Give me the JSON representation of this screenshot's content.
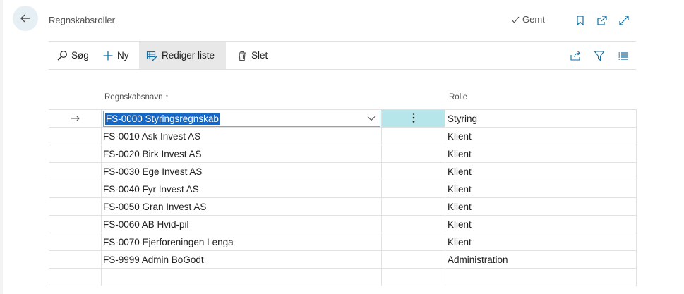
{
  "page": {
    "title": "Regnskabsroller",
    "saved_label": "Gemt"
  },
  "toolbar": {
    "search_label": "Søg",
    "new_label": "Ny",
    "edit_list_label": "Rediger liste",
    "delete_label": "Slet"
  },
  "columns": {
    "name_header": "Regnskabsnavn ↑",
    "role_header": "Rolle"
  },
  "rows": [
    {
      "name": "FS-0000 Styringsregnskab",
      "role": "Styring",
      "selected": true
    },
    {
      "name": "FS-0010 Ask Invest AS",
      "role": "Klient"
    },
    {
      "name": "FS-0020 Birk Invest AS",
      "role": "Klient"
    },
    {
      "name": "FS-0030 Ege Invest AS",
      "role": "Klient"
    },
    {
      "name": "FS-0040 Fyr Invest AS",
      "role": "Klient"
    },
    {
      "name": "FS-0050 Gran Invest AS",
      "role": "Klient"
    },
    {
      "name": "FS-0060 AB Hvid-pil",
      "role": "Klient"
    },
    {
      "name": "FS-0070 Ejerforeningen Lenga",
      "role": "Klient"
    },
    {
      "name": "FS-9999 Admin BoGodt",
      "role": "Administration"
    }
  ],
  "icons": {
    "back": "back-arrow-icon",
    "check": "checkmark-icon",
    "bookmark": "bookmark-icon",
    "open_new": "open-new-window-icon",
    "expand": "expand-icon",
    "search": "search-icon",
    "new": "plus-icon",
    "edit_list": "edit-list-icon",
    "delete": "trash-icon",
    "share": "share-icon",
    "filter": "filter-icon",
    "list": "list-view-icon",
    "row_pointer": "row-arrow-icon",
    "dropdown": "chevron-down-icon",
    "row_menu": "ellipsis-vertical-icon"
  },
  "colors": {
    "accent": "#1767c4",
    "selected_cell": "#b6e5ea",
    "back_button_bg": "#e6f0f4",
    "icon_blue": "#0f6fa8"
  }
}
